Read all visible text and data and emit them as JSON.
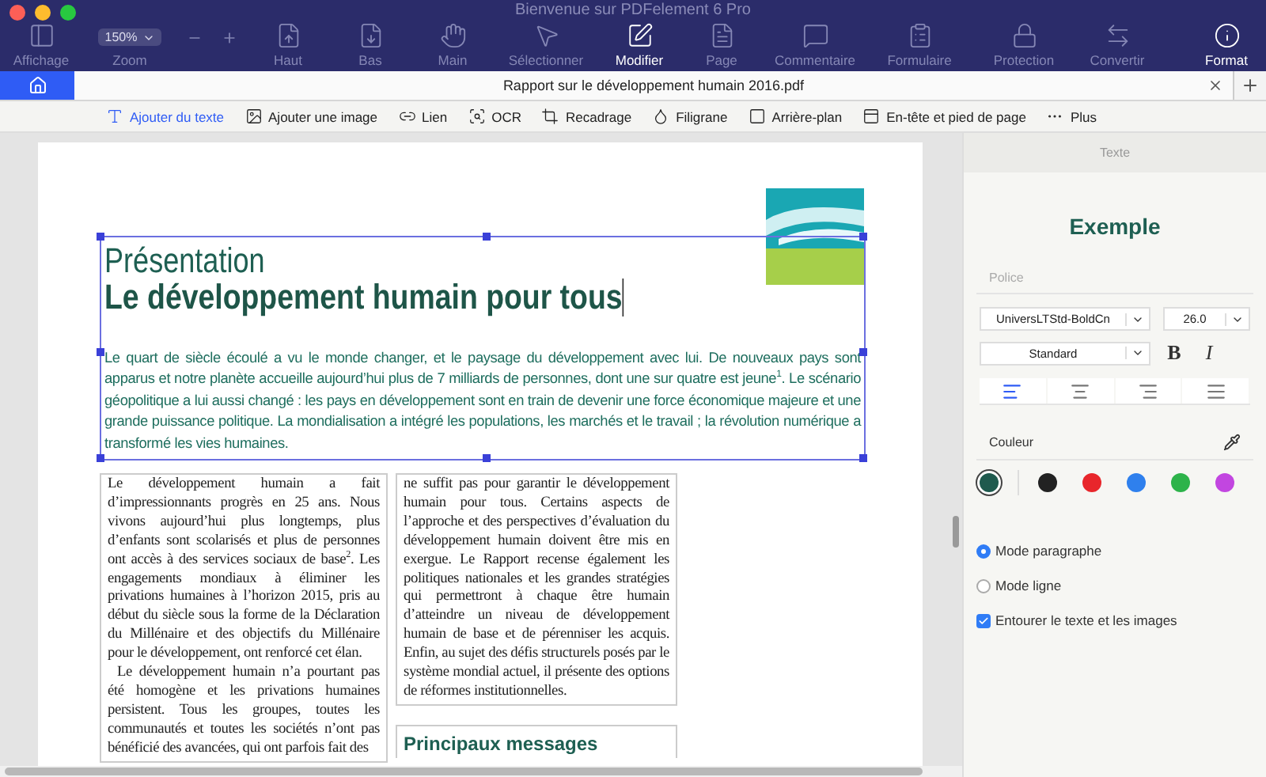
{
  "window": {
    "title": "Bienvenue sur PDFelement 6 Pro"
  },
  "toolbar": {
    "view": {
      "label": "Affichage",
      "selected": false
    },
    "zoom": {
      "value": "150%",
      "label": "Zoom"
    },
    "items": [
      {
        "label": "Haut",
        "selected": false
      },
      {
        "label": "Bas",
        "selected": false
      },
      {
        "label": "Main",
        "selected": false
      },
      {
        "label": "Sélectionner",
        "selected": false
      },
      {
        "label": "Modifier",
        "selected": true
      },
      {
        "label": "Page",
        "selected": false
      },
      {
        "label": "Commentaire",
        "selected": false
      },
      {
        "label": "Formulaire",
        "selected": false
      },
      {
        "label": "Protection",
        "selected": false
      },
      {
        "label": "Convertir",
        "selected": false
      }
    ],
    "format": {
      "label": "Format",
      "selected": true
    }
  },
  "tab": {
    "title": "Rapport sur le développement humain 2016.pdf"
  },
  "edit_tools": [
    {
      "label": "Ajouter du texte",
      "selected": true
    },
    {
      "label": "Ajouter une image",
      "selected": false
    },
    {
      "label": "Lien",
      "selected": false
    },
    {
      "label": "OCR",
      "selected": false
    },
    {
      "label": "Recadrage",
      "selected": false
    },
    {
      "label": "Filigrane",
      "selected": false
    },
    {
      "label": "Arrière-plan",
      "selected": false
    },
    {
      "label": "En-tête et pied de page",
      "selected": false
    },
    {
      "label": "Plus",
      "selected": false
    }
  ],
  "document": {
    "subtitle": "Présentation",
    "title": "Le développement humain pour tous",
    "intro": "Le quart de siècle écoulé a vu le monde changer, et le paysage du développement avec lui. De nouveaux pays sont apparus et notre planète accueille aujourd’hui plus de 7 milliards de personnes, dont une sur quatre est jeune$^{1}$. Le scénario géopolitique a lui aussi changé : les pays en développement sont en train de devenir une force économique majeure et une grande puissance politique. La mondialisation a intégré les populations, les marchés et le travail ; la révolution numérique a transformé les vies humaines.",
    "column_1": [
      "Le développement humain a fait d’impressionnants progrès en 25 ans. Nous vivons aujourd’hui plus longtemps, plus d’enfants sont scolarisés et plus de personnes ont accès à des services sociaux de base$^{2}$. Les engagements mondiaux à éliminer les privations humaines à l’horizon 2015, pris au début du siècle sous la forme de la Déclaration du Millénaire et des objectifs du Millénaire pour le développement, ont renforcé cet élan.",
      "Le développement humain n’a pourtant pas été homogène et les privations humaines persistent. Tous les groupes, toutes les communautés et toutes les sociétés n’ont pas bénéficié des avancées, qui ont parfois fait des"
    ],
    "column_2": "ne suffit pas pour garantir le développement humain pour tous. Certains aspects de l’approche et des perspectives d’évaluation du développement humain doivent être mis en exergue. Le Rapport recense également les politiques nationales et les grandes stratégies qui permettront à chaque être humain d’atteindre un niveau de développement humain de base et de pérenniser les acquis. Enfin, au sujet des défis structurels posés par le système mondial actuel, il présente des options de réformes institutionnelles.",
    "box_heading": "Principaux messages"
  },
  "panel": {
    "header": "Texte",
    "preview": "Exemple",
    "font_label": "Police",
    "font": "UniversLTStd-BoldCn",
    "size": "26.0",
    "style": "Standard",
    "bold": "B",
    "italic": "I",
    "alignments": [
      {
        "selected": true
      },
      {
        "selected": false
      },
      {
        "selected": false
      },
      {
        "selected": false
      }
    ],
    "color_label": "Couleur",
    "swatches": [
      {
        "color": "#1f5a4e",
        "selected": true
      },
      {
        "color": "#222222",
        "selected": false
      },
      {
        "color": "#e8262b",
        "selected": false
      },
      {
        "color": "#2f80ed",
        "selected": false
      },
      {
        "color": "#2db34a",
        "selected": false
      },
      {
        "color": "#c246e0",
        "selected": false
      }
    ],
    "modes": [
      {
        "label": "Mode paragraphe",
        "selected": true
      },
      {
        "label": "Mode ligne",
        "selected": false
      }
    ],
    "wrap": {
      "label": "Entourer le texte et les images",
      "checked": true
    }
  }
}
